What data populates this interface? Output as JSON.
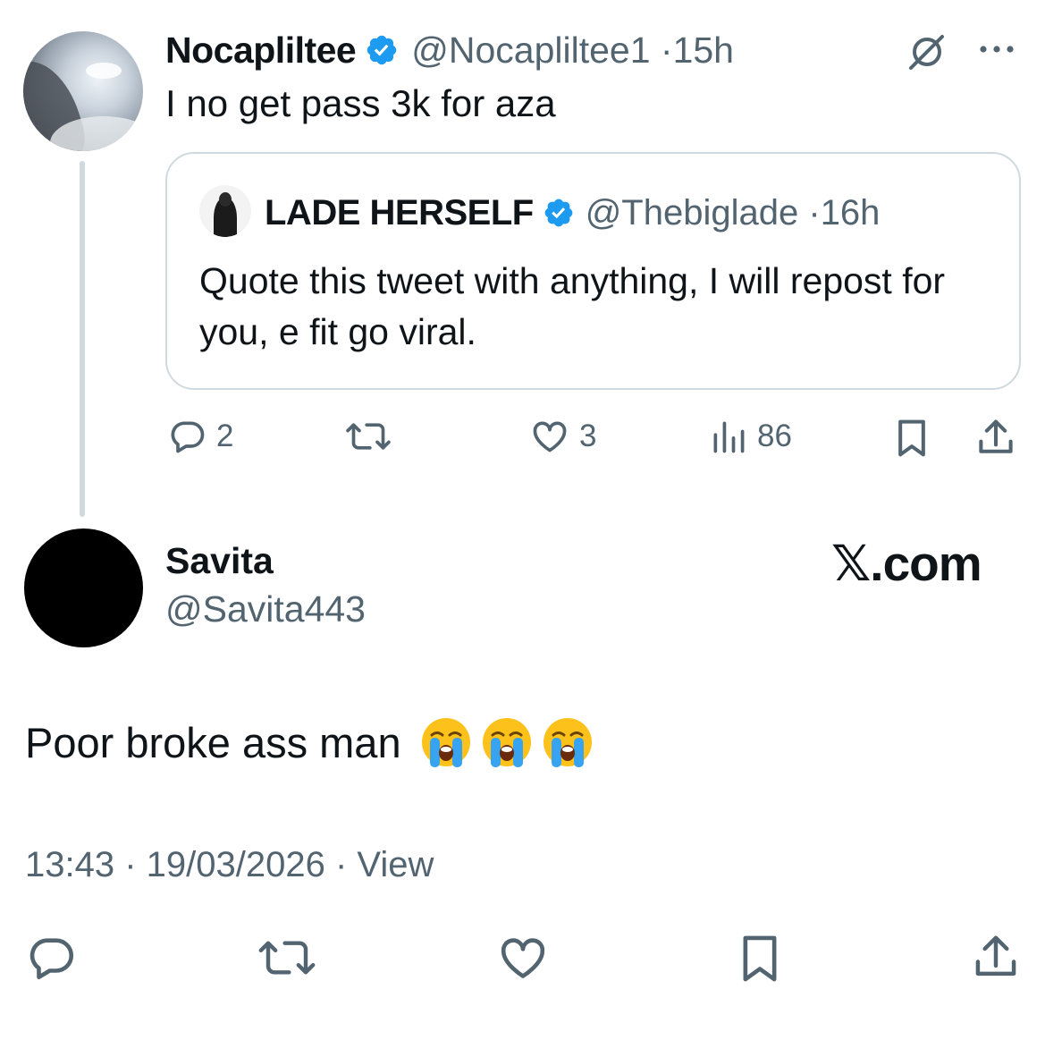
{
  "parent_tweet": {
    "display_name": "Nocapliltee",
    "handle": "@Nocapliltee1",
    "time": "15h",
    "text": "I no get pass 3k for aza",
    "quote": {
      "display_name": "LADE HERSELF",
      "handle": "@Thebiglade",
      "time": "16h",
      "text": "Quote this tweet with anything, I will repost for you, e fit go viral."
    },
    "actions": {
      "replies": "2",
      "likes": "3",
      "views": "86"
    }
  },
  "main_tweet": {
    "display_name": "Savita",
    "handle": "@Savita443",
    "watermark": "𝕏.com",
    "text": "Poor broke ass man",
    "emojis": [
      "loudly-crying-face",
      "loudly-crying-face",
      "loudly-crying-face"
    ],
    "meta": "13:43 · 19/03/2026 · View"
  },
  "separator": "·",
  "colors": {
    "text_primary": "#0f1419",
    "text_secondary": "#536471",
    "verified_blue": "#1d9bf0",
    "border": "#cfd9de"
  },
  "icons": {
    "verified": "verified-badge-icon",
    "grok": "grok-icon",
    "more": "more-icon",
    "reply": "reply-icon",
    "repost": "repost-icon",
    "like": "like-icon",
    "views": "views-icon",
    "bookmark": "bookmark-icon",
    "share": "share-icon"
  }
}
